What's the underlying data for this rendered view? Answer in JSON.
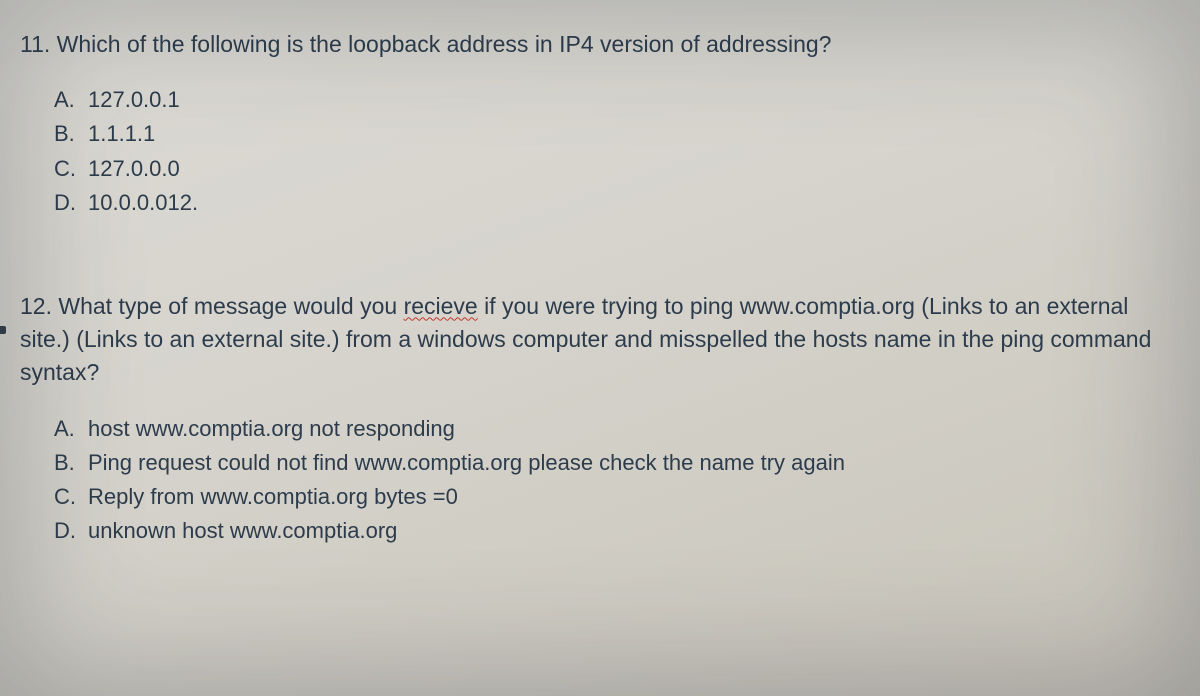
{
  "q11": {
    "number": "11.",
    "text": "Which of the following is the loopback address in IP4 version of addressing?",
    "options": {
      "a_letter": "A.",
      "a_text": "127.0.0.1",
      "b_letter": "B.",
      "b_text": "1.1.1.1",
      "c_letter": "C.",
      "c_text": "127.0.0.0",
      "d_letter": "D.",
      "d_text": "10.0.0.012."
    }
  },
  "q12": {
    "number": "12.",
    "text_pre": "What type of message would you ",
    "misspelled": "recieve",
    "text_post": " if you were trying to ping www.comptia.org (Links to an external site.) (Links to an external site.) from a windows computer and misspelled the hosts name in the ping command syntax?",
    "options": {
      "a_letter": "A.",
      "a_text": "host www.comptia.org not responding",
      "b_letter": "B.",
      "b_text": "Ping request could not find www.comptia.org please check the name try again",
      "c_letter": "C.",
      "c_text": "Reply from www.comptia.org bytes =0",
      "d_letter": "D.",
      "d_text": "unknown host www.comptia.org"
    }
  }
}
